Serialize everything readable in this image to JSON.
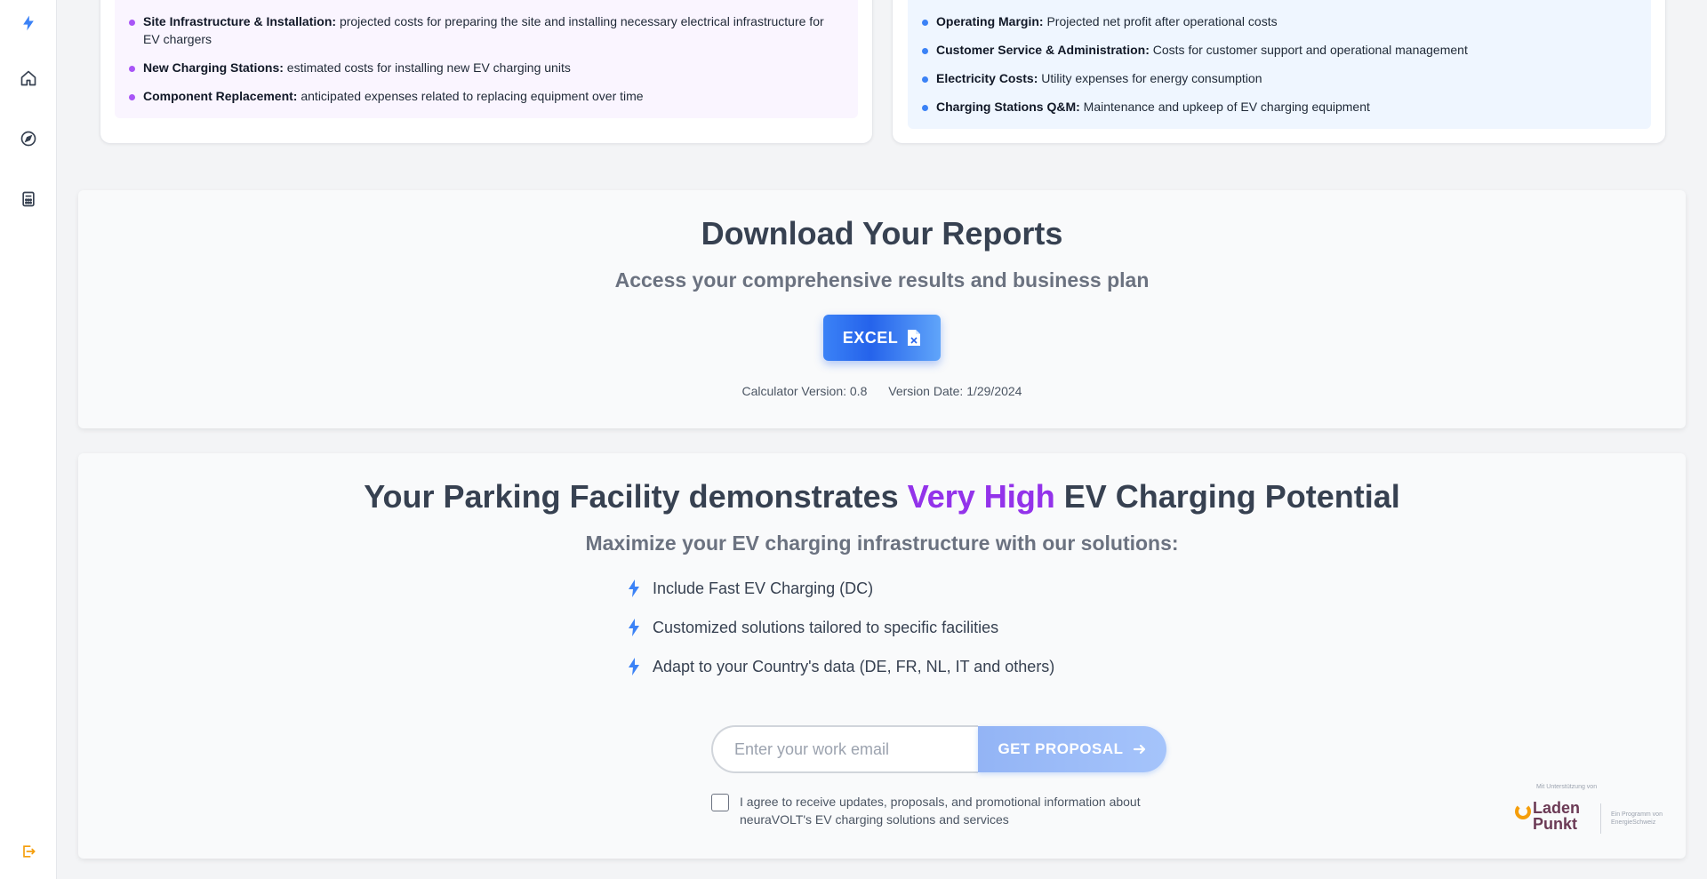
{
  "sidebar": {
    "items": [
      {
        "icon": "bolt-icon"
      },
      {
        "icon": "home-icon"
      },
      {
        "icon": "compass-icon"
      },
      {
        "icon": "calculator-icon"
      },
      {
        "icon": "logout-icon"
      }
    ]
  },
  "costs": {
    "items": [
      {
        "title": "Site Infrastructure & Installation:",
        "text": "projected costs for preparing the site and installing necessary electrical infrastructure for EV chargers"
      },
      {
        "title": "New Charging Stations:",
        "text": "estimated costs for installing new EV charging units"
      },
      {
        "title": "Component Replacement:",
        "text": "anticipated expenses related to replacing equipment over time"
      }
    ]
  },
  "operations": {
    "items": [
      {
        "title": "Operating Margin:",
        "text": "Projected net profit after operational costs"
      },
      {
        "title": "Customer Service & Administration:",
        "text": "Costs for customer support and operational management"
      },
      {
        "title": "Electricity Costs:",
        "text": "Utility expenses for energy consumption"
      },
      {
        "title": "Charging Stations Q&M:",
        "text": "Maintenance and upkeep of EV charging equipment"
      }
    ]
  },
  "reports": {
    "title": "Download Your Reports",
    "subtitle": "Access your comprehensive results and business plan",
    "excel_label": "EXCEL",
    "version_label": "Calculator Version: 0.8",
    "date_label": "Version Date: 1/29/2024"
  },
  "potential": {
    "title_pre": "Your Parking Facility demonstrates ",
    "title_highlight": "Very High",
    "title_post": " EV Charging Potential",
    "subtitle": "Maximize your EV charging infrastructure with our solutions:",
    "features": [
      "Include Fast EV Charging (DC)",
      "Customized solutions tailored to specific facilities",
      "Adapt to your Country's data (DE, FR, NL, IT and others)"
    ],
    "email_placeholder": "Enter your work email",
    "proposal_label": "GET PROPOSAL",
    "consent_text": "I agree to receive updates, proposals, and promotional information about neuraVOLT's EV charging solutions and services"
  },
  "logo": {
    "supported_by": "Mit Unterstützung von",
    "name_line1": "Laden",
    "name_line2": "Punkt",
    "program": "Ein Programm von EnergieSchweiz"
  },
  "colors": {
    "accent": "#3b82f6",
    "highlight": "#9333ea",
    "logout": "#f59e0b"
  }
}
